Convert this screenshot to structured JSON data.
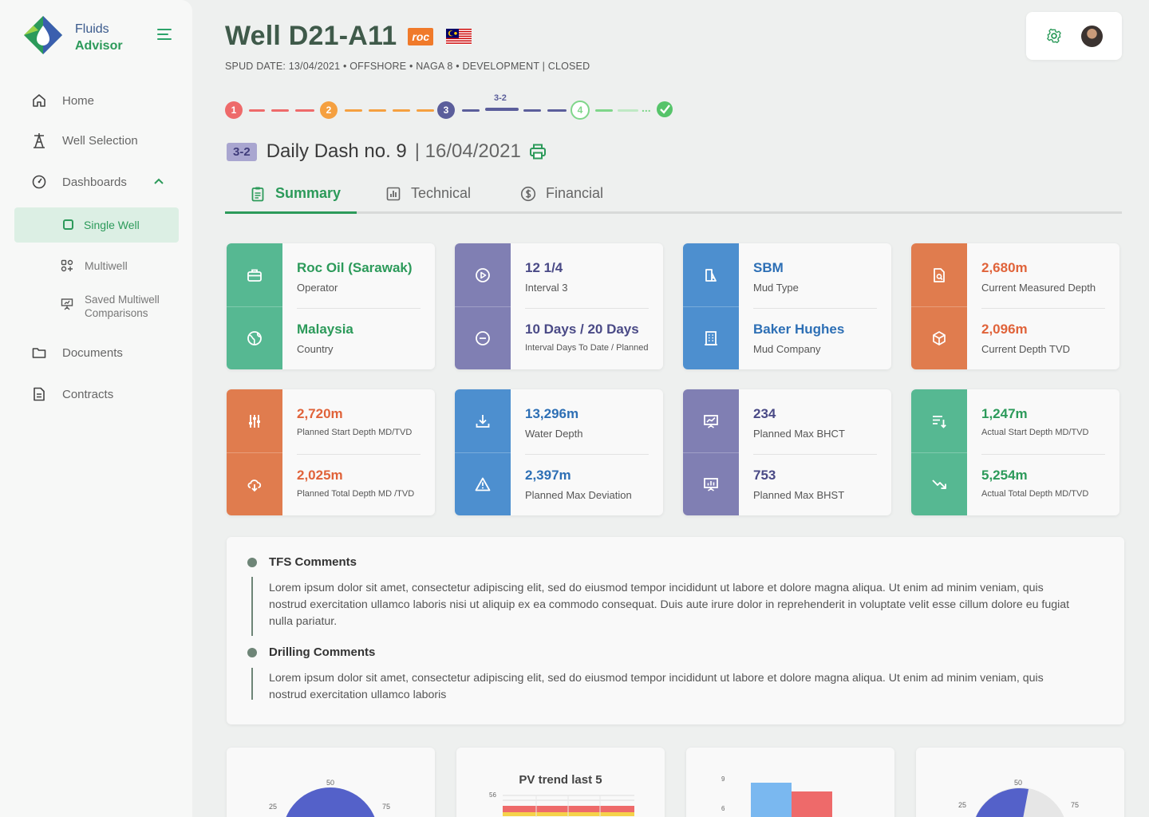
{
  "app": {
    "brand_line1": "Fluids",
    "brand_line2": "Advisor"
  },
  "sidebar": {
    "items": [
      {
        "label": "Home",
        "icon": "home-icon"
      },
      {
        "label": "Well Selection",
        "icon": "oil-rig-icon"
      },
      {
        "label": "Dashboards",
        "icon": "gauge-icon"
      },
      {
        "label": "Single Well",
        "icon": "square-icon"
      },
      {
        "label": "Multiwell",
        "icon": "grid-icon"
      },
      {
        "label_line1": "Saved Multiwell",
        "label_line2": "Comparisons",
        "icon": "presentation-icon"
      },
      {
        "label": "Documents",
        "icon": "folder-icon"
      },
      {
        "label": "Contracts",
        "icon": "document-icon"
      }
    ]
  },
  "header": {
    "title": "Well D21-A11",
    "operator_logo_text": "roc",
    "subtitle": "SPUD DATE: 13/04/2021 • OFFSHORE • NAGA 8 • DEVELOPMENT | CLOSED"
  },
  "stepper": {
    "steps": [
      "1",
      "2",
      "3",
      "4"
    ],
    "current_label": "3-2",
    "colors": {
      "step1": "#ee6a6a",
      "step2": "#f5a040",
      "step3": "#5b5e9b",
      "step4": "#7fd68a"
    }
  },
  "dash": {
    "badge": "3-2",
    "title": "Daily Dash no. 9",
    "date": "| 16/04/2021"
  },
  "tabs": [
    {
      "label": "Summary",
      "active": true
    },
    {
      "label": "Technical",
      "active": false
    },
    {
      "label": "Financial",
      "active": false
    }
  ],
  "cards": [
    {
      "color": "#56b892",
      "text_color": "#2c9a5a",
      "top": {
        "value": "Roc Oil (Sarawak)",
        "label": "Operator",
        "icon": "briefcase-icon"
      },
      "bottom": {
        "value": "Malaysia",
        "label": "Country",
        "icon": "globe-icon"
      }
    },
    {
      "color": "#807fb3",
      "text_color": "#4a4a86",
      "top": {
        "value": "12 1/4",
        "label": "Interval 3",
        "icon": "play-circle-icon"
      },
      "bottom": {
        "value": "10 Days / 20 Days",
        "label": "Interval Days To Date / Planned",
        "icon": "minus-circle-icon"
      }
    },
    {
      "color": "#4d8fcf",
      "text_color": "#2d6fb5",
      "top": {
        "value": "SBM",
        "label": "Mud Type",
        "icon": "flask-icon"
      },
      "bottom": {
        "value": "Baker Hughes",
        "label": "Mud Company",
        "icon": "building-icon"
      }
    },
    {
      "color": "#e07c4e",
      "text_color": "#e0633a",
      "top": {
        "value": "2,680m",
        "label": "Current Measured Depth",
        "icon": "file-search-icon"
      },
      "bottom": {
        "value": "2,096m",
        "label": "Current Depth TVD",
        "icon": "cube-icon"
      }
    },
    {
      "color": "#e07c4e",
      "text_color": "#e0633a",
      "top": {
        "value": "2,720m",
        "label": "Planned Start Depth MD/TVD",
        "icon": "sliders-icon"
      },
      "bottom": {
        "value": "2,025m",
        "label": "Planned Total Depth MD /TVD",
        "icon": "cloud-download-icon"
      }
    },
    {
      "color": "#4d8fcf",
      "text_color": "#2d6fb5",
      "top": {
        "value": "13,296m",
        "label": "Water Depth",
        "icon": "download-tray-icon"
      },
      "bottom": {
        "value": "2,397m",
        "label": "Planned Max Deviation",
        "icon": "warning-icon"
      }
    },
    {
      "color": "#807fb3",
      "text_color": "#4a4a86",
      "top": {
        "value": "234",
        "label": "Planned Max BHCT",
        "icon": "presentation-chart-icon"
      },
      "bottom": {
        "value": "753",
        "label": "Planned Max BHST",
        "icon": "presentation-bars-icon"
      }
    },
    {
      "color": "#56b892",
      "text_color": "#2c9a5a",
      "top": {
        "value": "1,247m",
        "label": "Actual Start Depth MD/TVD",
        "icon": "sort-down-icon"
      },
      "bottom": {
        "value": "5,254m",
        "label": "Actual Total Depth MD/TVD",
        "icon": "trend-down-icon"
      }
    }
  ],
  "comments": [
    {
      "heading": "TFS Comments",
      "body": "Lorem ipsum dolor sit amet, consectetur adipiscing elit, sed do eiusmod tempor incididunt ut labore et dolore magna aliqua. Ut enim ad minim veniam, quis nostrud exercitation ullamco laboris nisi ut aliquip ex ea commodo consequat. Duis aute irure dolor in reprehenderit in voluptate velit esse cillum dolore eu fugiat nulla pariatur."
    },
    {
      "heading": "Drilling Comments",
      "body": "Lorem ipsum dolor sit amet, consectetur adipiscing elit, sed do eiusmod tempor incididunt ut labore et dolore magna aliqua. Ut enim ad minim veniam, quis nostrud exercitation ullamco laboris"
    }
  ],
  "chart_data": [
    {
      "type": "gauge",
      "tick_labels": [
        "25",
        "50",
        "75"
      ],
      "color": "#5461c9"
    },
    {
      "type": "bar",
      "title": "PV trend last 5",
      "y_tick_labels": [
        "56"
      ],
      "colors": [
        "#ee6a6a",
        "#f5d24a"
      ]
    },
    {
      "type": "bar",
      "y_tick_labels": [
        "9",
        "6"
      ],
      "values": [
        9,
        8.8
      ],
      "colors": [
        "#7ab8f0",
        "#ee6a6a"
      ]
    },
    {
      "type": "gauge",
      "tick_labels": [
        "25",
        "50",
        "75"
      ],
      "color": "#5461c9"
    }
  ]
}
